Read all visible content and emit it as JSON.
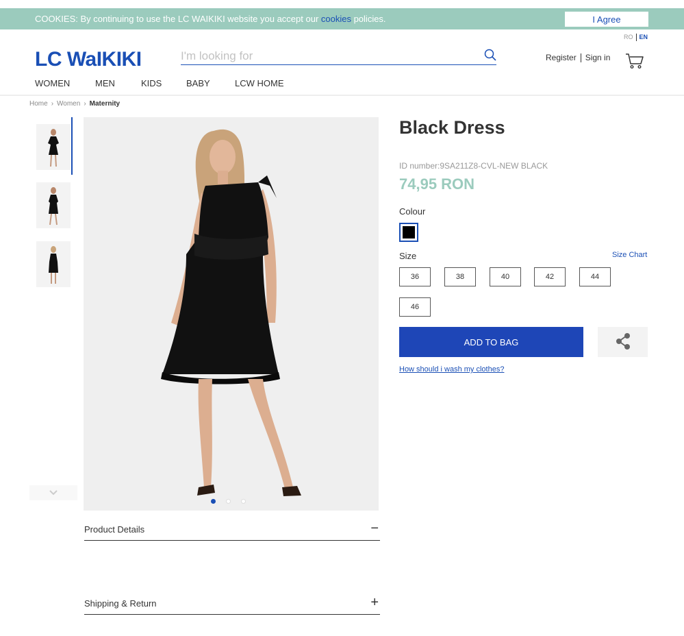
{
  "cookie_bar": {
    "text_before": "COOKIES: By continuing to use the LC WAIKIKI website you accept our ",
    "link": "cookies",
    "text_after": " policies.",
    "agree_label": "I Agree"
  },
  "lang": {
    "ro": "RO",
    "en": "EN"
  },
  "header": {
    "logo": "LC WaIKIKI",
    "search_placeholder": "I'm looking for",
    "register": "Register",
    "sign_in": "Sign in"
  },
  "nav": [
    "WOMEN",
    "MEN",
    "KIDS",
    "BABY",
    "LCW HOME"
  ],
  "breadcrumb": {
    "home": "Home",
    "women": "Women",
    "current": "Maternity"
  },
  "product": {
    "title": "Black Dress",
    "sku": "ID number:9SA211Z8-CVL-NEW BLACK",
    "price": "74,95 RON",
    "colour_label": "Colour",
    "colour_value": "#000000",
    "size_label": "Size",
    "size_chart": "Size Chart",
    "sizes": [
      "36",
      "38",
      "40",
      "42",
      "44",
      "46"
    ],
    "add_to_bag": "ADD TO BAG",
    "wash_link": "How should i wash my clothes?"
  },
  "accordion": {
    "details": "Product Details",
    "details_icon": "−",
    "shipping": "Shipping & Return",
    "shipping_icon": "+"
  },
  "colors": {
    "brand": "#1a4fb5",
    "accent": "#9bcbbd",
    "button": "#1e46b7"
  },
  "icons": [
    "search-icon",
    "cart-icon",
    "share-icon",
    "chevron-down-icon",
    "minus-icon",
    "plus-icon"
  ]
}
